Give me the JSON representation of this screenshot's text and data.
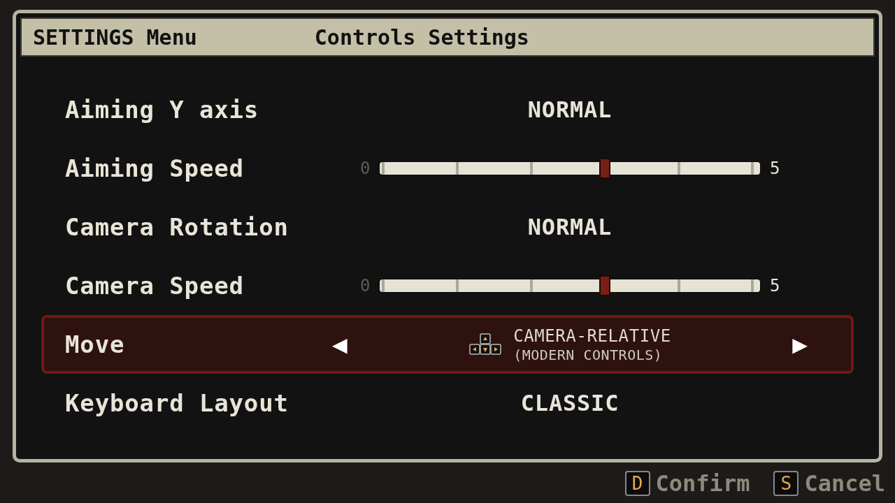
{
  "header": {
    "menu_title": "SETTINGS Menu",
    "section_title": "Controls Settings"
  },
  "rows": [
    {
      "kind": "option",
      "label": "Aiming Y axis",
      "value": "NORMAL",
      "selected": false
    },
    {
      "kind": "slider",
      "label": "Aiming Speed",
      "min": "0",
      "max": "5",
      "level": 0.6,
      "selected": false
    },
    {
      "kind": "option",
      "label": "Camera Rotation",
      "value": "NORMAL",
      "selected": false
    },
    {
      "kind": "slider",
      "label": "Camera Speed",
      "min": "0",
      "max": "5",
      "level": 0.6,
      "selected": false
    },
    {
      "kind": "selector",
      "label": "Move",
      "value": "CAMERA-RELATIVE",
      "subvalue": "(MODERN CONTROLS)",
      "left_arrow": "◀",
      "right_arrow": "▶",
      "selected": true
    },
    {
      "kind": "option",
      "label": "Keyboard Layout",
      "value": "CLASSIC",
      "selected": false
    }
  ],
  "footer": [
    {
      "key": "D",
      "label": "Confirm"
    },
    {
      "key": "S",
      "label": "Cancel"
    }
  ]
}
